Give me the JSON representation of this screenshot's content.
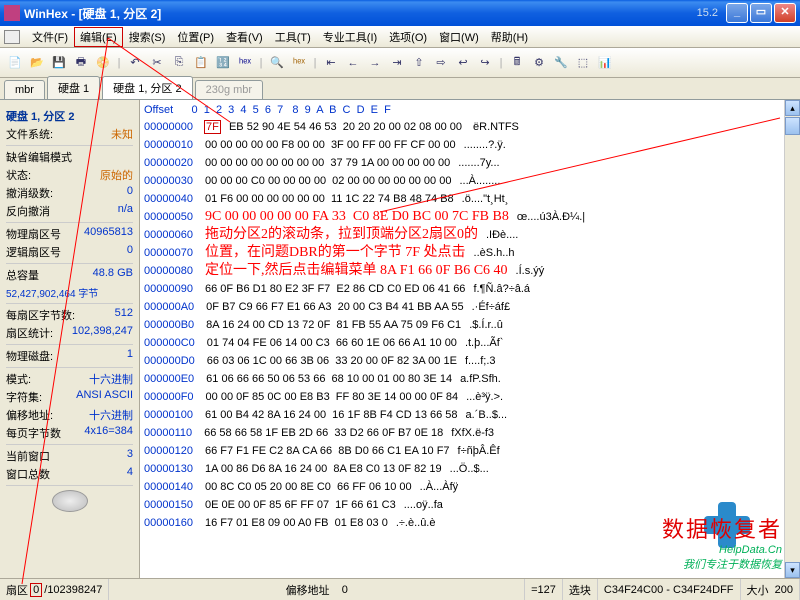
{
  "title": "WinHex - [硬盘 1, 分区 2]",
  "version": "15.2",
  "menu": {
    "file": "文件(F)",
    "edit": "编辑(E)",
    "search": "搜索(S)",
    "pos": "位置(P)",
    "view": "查看(V)",
    "tools": "工具(T)",
    "pro": "专业工具(I)",
    "opts": "选项(O)",
    "win": "窗口(W)",
    "help": "帮助(H)"
  },
  "tabs": {
    "t1": "mbr",
    "t2": "硬盘 1",
    "t3": "硬盘 1, 分区 2",
    "t4": "230g mbr"
  },
  "side": {
    "hdr1": "硬盘 1, 分区 2",
    "fs_l": "文件系统:",
    "fs_v": "未知",
    "mode_l": "缺省编辑模式",
    "state_l": "状态:",
    "state_v": "原始的",
    "undo_l": "撤消级数:",
    "undo_v": "0",
    "rev_l": "反向撤消",
    "rev_v": "n/a",
    "psec_l": "物理扇区号",
    "psec_v": "40965813",
    "lsec_l": "逻辑扇区号",
    "lsec_v": "0",
    "cap_l": "总容量",
    "cap_v": "48.8 GB",
    "cap2": "52,427,902,464 字节",
    "bps_l": "每扇区字节数:",
    "bps_v": "512",
    "sec_l": "扇区统计:",
    "sec_v": "102,398,247",
    "pd_l": "物理磁盘:",
    "pd_v": "1",
    "md_l": "模式:",
    "md_v": "十六进制",
    "cs_l": "字符集:",
    "cs_v": "ANSI ASCII",
    "off_l": "偏移地址:",
    "off_v": "十六进制",
    "bpp_l": "每页字节数",
    "bpp_v": "4x16=384",
    "cw_l": "当前窗口",
    "cw_v": "3",
    "tw_l": "窗口总数",
    "tw_v": "4"
  },
  "hexheader": "Offset      0  1  2  3  4  5  6  7   8  9  A  B  C  D  E  F",
  "rows": [
    {
      "o": "00000000",
      "h": "   EB 52 90 4E 54 46 53  20 20 20 00 02 08 00 00",
      "a": " ëR.NTFS",
      "f": "7F"
    },
    {
      "o": "00000010",
      "h": "00 00 00 00 00 F8 00 00  3F 00 FF 00 FF CF 00 00",
      "a": "........?.ÿ."
    },
    {
      "o": "00000020",
      "h": "00 00 00 00 00 00 00 00  37 79 1A 00 00 00 00 00",
      "a": ".......7y..."
    },
    {
      "o": "00000030",
      "h": "00 00 00 C0 00 00 00 00  02 00 00 00 00 00 00 00",
      "a": "...À........"
    },
    {
      "o": "00000040",
      "h": "01 F6 00 00 00 00 00 00  11 1C 22 74 B8 48 74 B8",
      "a": ".ö....\"t¸Ht¸"
    },
    {
      "o": "00000050",
      "h": "9C 00 00 00 00 00 FA 33  C0 8E D0 BC 00 7C FB B8",
      "a": "œ....ú3À.Ð¼.|"
    },
    {
      "o": "00000060",
      "h": "拖动分区2的滚动条，拉到顶端分区2扇区0的",
      "a": ".IÐè...."
    },
    {
      "o": "00000070",
      "h": "位置，在问题DBR的第一个字节 7F 处点击",
      "a": "..èS.h..h"
    },
    {
      "o": "00000080",
      "h": "定位一下,然后点击编辑菜单 8A F1 66 0F B6 C6 40",
      "a": ".Í.s.ýý"
    },
    {
      "o": "00000090",
      "h": "66 0F B6 D1 80 E2 3F F7  E2 86 CD C0 ED 06 41 66",
      "a": "f.¶Ñ.â?÷â.á"
    },
    {
      "o": "000000A0",
      "h": "0F B7 C9 66 F7 E1 66 A3  20 00 C3 B4 41 BB AA 55",
      "a": ".·Éf÷áf£"
    },
    {
      "o": "000000B0",
      "h": "8A 16 24 00 CD 13 72 0F  81 FB 55 AA 75 09 F6 C1",
      "a": ".$.Í.r..û"
    },
    {
      "o": "000000C0",
      "h": "01 74 04 FE 06 14 00 C3  66 60 1E 06 66 A1 10 00",
      "a": ".t.þ...Ãf`"
    },
    {
      "o": "000000D0",
      "h": "66 03 06 1C 00 66 3B 06  33 20 00 0F 82 3A 00 1E",
      "a": "f....f;.3"
    },
    {
      "o": "000000E0",
      "h": "61 06 66 66 50 06 53 66  68 10 00 01 00 80 3E 14",
      "a": "a.fP.Sfh."
    },
    {
      "o": "000000F0",
      "h": "00 00 0F 85 0C 00 E8 B3  FF 80 3E 14 00 00 0F 84",
      "a": "...è³ÿ.>."
    },
    {
      "o": "00000100",
      "h": "61 00 B4 42 8A 16 24 00  16 1F 8B F4 CD 13 66 58",
      "a": "a.´B..$..."
    },
    {
      "o": "00000110",
      "h": "66 58 66 58 1F EB 2D 66  33 D2 66 0F B7 0E 18",
      "a": "fXfX.ë-f3"
    },
    {
      "o": "00000120",
      "h": "66 F7 F1 FE C2 8A CA 66  8B D0 66 C1 EA 10 F7",
      "a": "f÷ñþÂ.Êf"
    },
    {
      "o": "00000130",
      "h": "1A 00 86 D6 8A 16 24 00  8A E8 C0 13 0F 82 19",
      "a": "...Ö..$..."
    },
    {
      "o": "00000140",
      "h": "00 8C C0 05 20 00 8E C0  66 FF 06 10 00",
      "a": "..À...Àfÿ"
    },
    {
      "o": "00000150",
      "h": "0E 0E 00 0F 85 6F FF 07  1F 66 61 C3",
      "a": "....oÿ..fa"
    },
    {
      "o": "00000160",
      "h": "16 F7 01 E8 09 00 A0 FB  01 E8 03 0",
      "a": ".÷.è..û.è"
    }
  ],
  "annot": "",
  "watermark": {
    "brand": "数据恢复者",
    "url": "HelpData.Cn",
    "tag": "我们专注于数据恢复"
  },
  "status": {
    "sec_l": "扇区",
    "sec_v": "0",
    "sec_t": "102398247",
    "off_l": "偏移地址",
    "off_v": "0",
    "eq": "=127",
    "sel_l": "选块",
    "range": "C34F24C00 - C34F24DFF",
    "size_l": "大小",
    "size_v": "200"
  }
}
